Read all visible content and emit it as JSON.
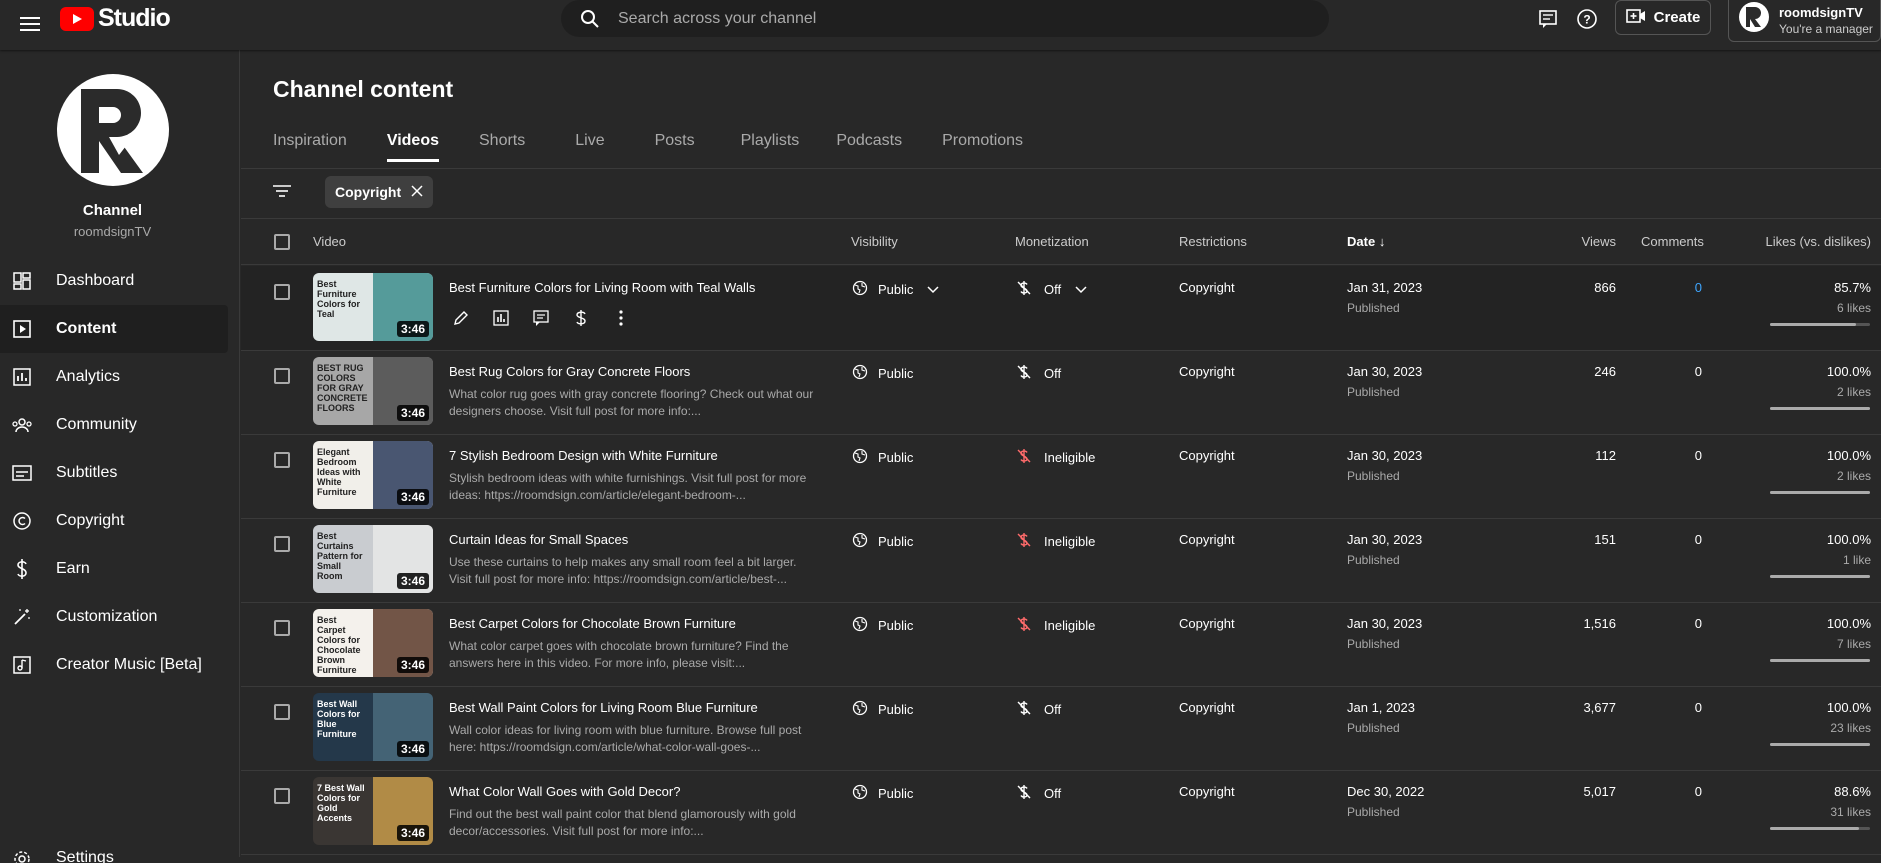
{
  "header": {
    "logo_text": "Studio",
    "search_placeholder": "Search across your channel",
    "create_label": "Create",
    "account_name": "roomdsignTV",
    "account_role": "You're a manager"
  },
  "sidebar": {
    "channel_title": "Channel",
    "channel_handle": "roomdsignTV",
    "items": [
      {
        "label": "Dashboard",
        "icon": "dashboard-icon"
      },
      {
        "label": "Content",
        "icon": "content-icon"
      },
      {
        "label": "Analytics",
        "icon": "analytics-icon"
      },
      {
        "label": "Community",
        "icon": "community-icon"
      },
      {
        "label": "Subtitles",
        "icon": "subtitles-icon"
      },
      {
        "label": "Copyright",
        "icon": "copyright-icon"
      },
      {
        "label": "Earn",
        "icon": "dollar-icon"
      },
      {
        "label": "Customization",
        "icon": "magic-wand-icon"
      },
      {
        "label": "Creator Music [Beta]",
        "icon": "music-icon"
      },
      {
        "label": "Settings",
        "icon": "gear-icon"
      }
    ]
  },
  "main": {
    "title": "Channel content",
    "tabs": [
      "Inspiration",
      "Videos",
      "Shorts",
      "Live",
      "Posts",
      "Playlists",
      "Podcasts",
      "Promotions"
    ],
    "active_tab": "Videos",
    "filter_chip": "Copyright",
    "columns": [
      "Video",
      "Visibility",
      "Monetization",
      "Restrictions",
      "Date",
      "Views",
      "Comments",
      "Likes (vs. dislikes)"
    ],
    "rows": [
      {
        "title": "Best Furniture Colors for Living Room with Teal Walls",
        "desc": "",
        "duration": "3:46",
        "thumb_text": "Best Furniture Colors for Teal",
        "thumb_bg": "#dfe7e6",
        "thumb_accent": "#3d8d8c",
        "visibility": "Public",
        "monetization": "Off",
        "restrictions": "Copyright",
        "date": "Jan 31, 2023",
        "status": "Published",
        "views": "866",
        "comments": "0",
        "likes_pct": "85.7%",
        "likes": "6 likes",
        "ratio": 0.857
      },
      {
        "title": "Best Rug Colors for Gray Concrete Floors",
        "desc": "What color rug goes with gray concrete flooring? Check out what our designers choose. Visit full post for more info:...",
        "duration": "3:46",
        "thumb_text": "BEST RUG COLORS FOR GRAY CONCRETE FLOORS",
        "thumb_bg": "#a7a7a7",
        "thumb_accent": "#4f4f4f",
        "visibility": "Public",
        "monetization": "Off",
        "restrictions": "Copyright",
        "date": "Jan 30, 2023",
        "status": "Published",
        "views": "246",
        "comments": "0",
        "likes_pct": "100.0%",
        "likes": "2 likes",
        "ratio": 1.0
      },
      {
        "title": "7 Stylish Bedroom Design with White Furniture",
        "desc": "Stylish bedroom ideas with white furnishings. Visit full post for more ideas: https://roomdsign.com/article/elegant-bedroom-...",
        "duration": "3:46",
        "thumb_text": "Elegant Bedroom Ideas with White Furniture",
        "thumb_bg": "#f1efea",
        "thumb_accent": "#2b3b5c",
        "visibility": "Public",
        "monetization": "Ineligible",
        "restrictions": "Copyright",
        "date": "Jan 30, 2023",
        "status": "Published",
        "views": "112",
        "comments": "0",
        "likes_pct": "100.0%",
        "likes": "2 likes",
        "ratio": 1.0
      },
      {
        "title": "Curtain Ideas for Small Spaces",
        "desc": "Use these curtains to help makes any small room feel a bit larger. Visit full post for more info: https://roomdsign.com/article/best-...",
        "duration": "3:46",
        "thumb_text": "Best Curtains Pattern for Small Room",
        "thumb_bg": "#c9ccd0",
        "thumb_accent": "#e8e8e8",
        "visibility": "Public",
        "monetization": "Ineligible",
        "restrictions": "Copyright",
        "date": "Jan 30, 2023",
        "status": "Published",
        "views": "151",
        "comments": "0",
        "likes_pct": "100.0%",
        "likes": "1 like",
        "ratio": 1.0
      },
      {
        "title": "Best Carpet Colors for Chocolate Brown Furniture",
        "desc": "What color carpet goes with chocolate brown furniture? Find the answers here in this video. For more info, please visit:...",
        "duration": "3:46",
        "thumb_text": "Best Carpet Colors for Chocolate Brown Furniture",
        "thumb_bg": "#f4f1ec",
        "thumb_accent": "#5a3a2a",
        "visibility": "Public",
        "monetization": "Ineligible",
        "restrictions": "Copyright",
        "date": "Jan 30, 2023",
        "status": "Published",
        "views": "1,516",
        "comments": "0",
        "likes_pct": "100.0%",
        "likes": "7 likes",
        "ratio": 1.0
      },
      {
        "title": "Best Wall Paint Colors for Living Room Blue Furniture",
        "desc": "Wall color ideas for living room with blue furniture. Browse full post here: https://roomdsign.com/article/what-color-wall-goes-...",
        "duration": "3:46",
        "thumb_text": "Best Wall Colors for Blue Furniture",
        "thumb_bg": "#24384a",
        "thumb_accent": "#4a6b7c",
        "visibility": "Public",
        "monetization": "Off",
        "restrictions": "Copyright",
        "date": "Jan 1, 2023",
        "status": "Published",
        "views": "3,677",
        "comments": "0",
        "likes_pct": "100.0%",
        "likes": "23 likes",
        "ratio": 1.0
      },
      {
        "title": "What Color Wall Goes with Gold Decor?",
        "desc": "Find out the best wall paint color that blend glamorously with gold decor/accessories. Visit full post for more info:...",
        "duration": "3:46",
        "thumb_text": "7 Best Wall Colors for Gold Accents",
        "thumb_bg": "#3a3633",
        "thumb_accent": "#c79a4a",
        "visibility": "Public",
        "monetization": "Off",
        "restrictions": "Copyright",
        "date": "Dec 30, 2022",
        "status": "Published",
        "views": "5,017",
        "comments": "0",
        "likes_pct": "88.6%",
        "likes": "31 likes",
        "ratio": 0.886
      }
    ]
  },
  "colors": {
    "background": "#282828",
    "comment_link": "#3ea6ff",
    "ineligible": "#ff6b6b",
    "brand_red": "#ff0000"
  }
}
